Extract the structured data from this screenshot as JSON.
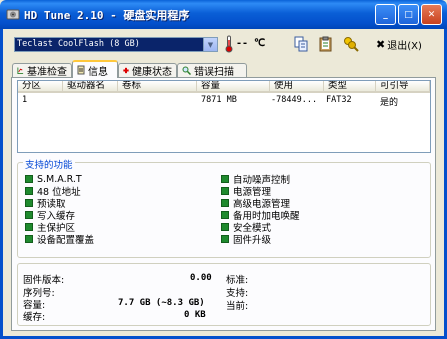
{
  "window": {
    "title": "HD Tune 2.10 - 硬盘实用程序",
    "minimize_glyph": "_",
    "maximize_glyph": "□",
    "close_glyph": "✕"
  },
  "toolbar": {
    "drive_selected": "Teclast CoolFlash (8 GB)",
    "temperature": "-- ℃",
    "exit_label": "退出(X)"
  },
  "tabs": [
    {
      "label": "基准检查",
      "icon": "benchmark-icon"
    },
    {
      "label": "信息",
      "icon": "info-icon",
      "active": true
    },
    {
      "label": "健康状态",
      "icon": "health-icon"
    },
    {
      "label": "错误扫描",
      "icon": "magnifier-icon"
    }
  ],
  "partition_table": {
    "columns": [
      "分区",
      "驱动器名",
      "卷标",
      "容量",
      "使用",
      "类型",
      "可引导"
    ],
    "rows": [
      [
        "1",
        "",
        "",
        "7871 MB",
        "-78449...",
        "FAT32",
        "是的"
      ]
    ]
  },
  "features": {
    "title": "支持的功能",
    "left": [
      "S.M.A.R.T",
      "48 位地址",
      "预读取",
      "写入缓存",
      "主保护区",
      "设备配置覆盖"
    ],
    "right": [
      "自动噪声控制",
      "电源管理",
      "高级电源管理",
      "备用时加电唤醒",
      "安全模式",
      "固件升级"
    ]
  },
  "details": {
    "firmware_label": "固件版本:",
    "firmware_value": "0.00",
    "serial_label": "序列号:",
    "serial_value": "",
    "capacity_label": "容量:",
    "capacity_value": "7.7 GB (~8.3 GB)",
    "cache_label": "缓存:",
    "cache_value": "0 KB",
    "standard_label": "标准:",
    "support_label": "支持:",
    "current_label": "当前:"
  },
  "colors": {
    "titlebar": "#0A5FD7",
    "feature_check": "#1F8A2E",
    "group_title": "#0046D5"
  }
}
